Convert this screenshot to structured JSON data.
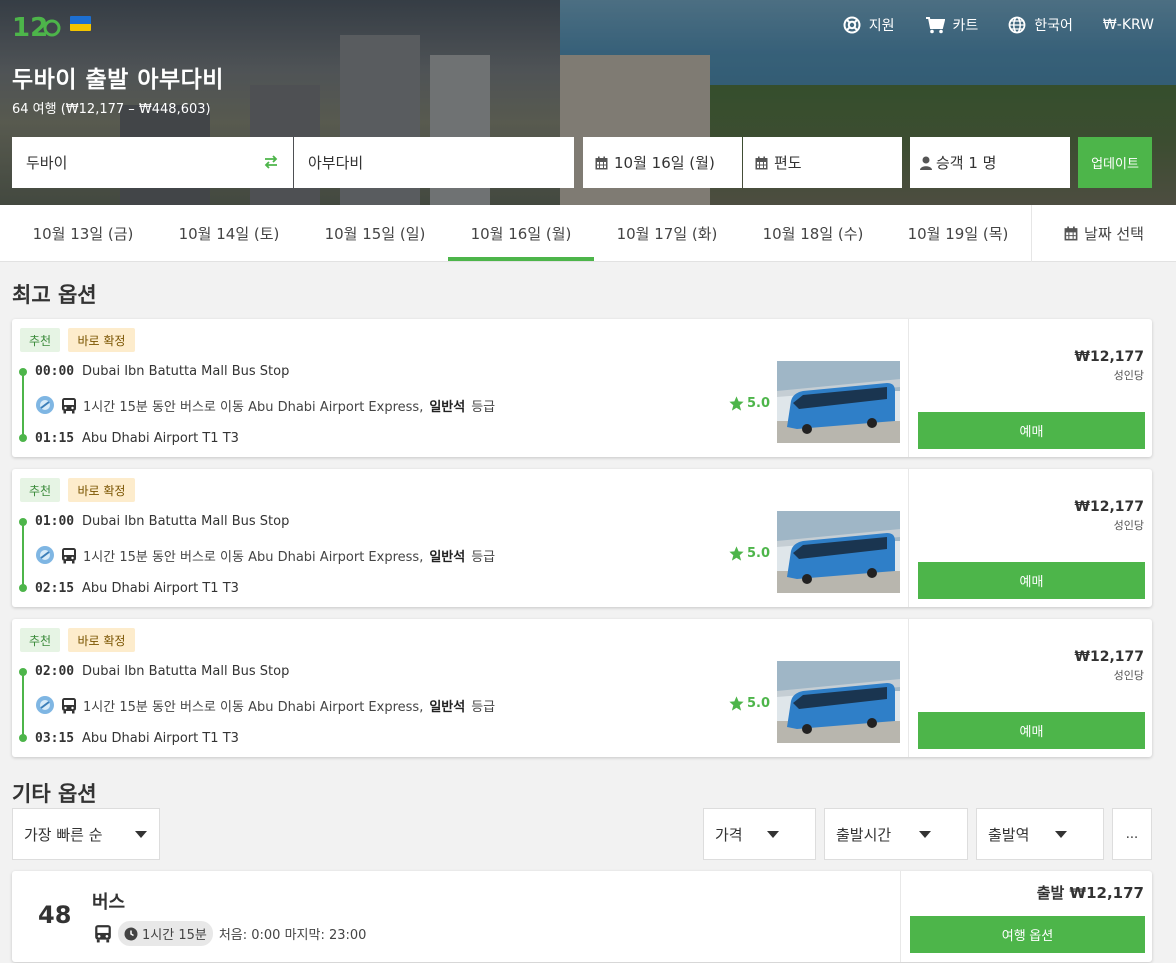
{
  "header": {
    "title": "두바이 출발 아부다비",
    "subtitle": "64 여행 (₩12,177 – ₩448,603)",
    "nav": {
      "support": "지원",
      "cart": "카트",
      "language": "한국어",
      "currency": "₩-KRW"
    }
  },
  "search": {
    "from": "두바이",
    "to": "아부다비",
    "date": "10월 16일 (월)",
    "return": "편도",
    "passengers": "승객 1 명",
    "update_label": "업데이트"
  },
  "date_tabs": [
    {
      "label": "10월 13일 (금)",
      "active": false
    },
    {
      "label": "10월 14일 (토)",
      "active": false
    },
    {
      "label": "10월 15일 (일)",
      "active": false
    },
    {
      "label": "10월 16일 (월)",
      "active": true
    },
    {
      "label": "10월 17일 (화)",
      "active": false
    },
    {
      "label": "10월 18일 (수)",
      "active": false
    },
    {
      "label": "10월 19일 (목)",
      "active": false
    }
  ],
  "date_pick_label": "날짜 선택",
  "best_options": {
    "title": "최고 옵션",
    "items": [
      {
        "badge_recommended": "추천",
        "badge_instant": "바로 확정",
        "depart_time": "00:00",
        "depart_stop": "Dubai Ibn Batutta Mall Bus Stop",
        "trip_text": "1시간 15분 동안 버스로 이동 Abu Dhabi Airport Express,",
        "class_text": "일반석",
        "class_suffix": "등급",
        "rating": "5.0",
        "arrive_time": "01:15",
        "arrive_stop": "Abu Dhabi Airport T1 T3",
        "price": "₩12,177",
        "per": "성인당",
        "buy_label": "예매"
      },
      {
        "badge_recommended": "추천",
        "badge_instant": "바로 확정",
        "depart_time": "01:00",
        "depart_stop": "Dubai Ibn Batutta Mall Bus Stop",
        "trip_text": "1시간 15분 동안 버스로 이동 Abu Dhabi Airport Express,",
        "class_text": "일반석",
        "class_suffix": "등급",
        "rating": "5.0",
        "arrive_time": "02:15",
        "arrive_stop": "Abu Dhabi Airport T1 T3",
        "price": "₩12,177",
        "per": "성인당",
        "buy_label": "예매"
      },
      {
        "badge_recommended": "추천",
        "badge_instant": "바로 확정",
        "depart_time": "02:00",
        "depart_stop": "Dubai Ibn Batutta Mall Bus Stop",
        "trip_text": "1시간 15분 동안 버스로 이동 Abu Dhabi Airport Express,",
        "class_text": "일반석",
        "class_suffix": "등급",
        "rating": "5.0",
        "arrive_time": "03:15",
        "arrive_stop": "Abu Dhabi Airport T1 T3",
        "price": "₩12,177",
        "per": "성인당",
        "buy_label": "예매"
      }
    ]
  },
  "other_options": {
    "title": "기타 옵션",
    "sort": "가장 빠른 순",
    "filters": {
      "price": "가격",
      "departure_time": "출발시간",
      "departure_station": "출발역",
      "more": "..."
    },
    "item": {
      "count": "48",
      "type": "버스",
      "duration": "1시간 15분",
      "schedule": "처음: 0:00 마지막: 23:00",
      "price": "출발 ₩12,177",
      "button": "여행 옵션"
    }
  },
  "colors": {
    "accent": "#4db54a",
    "badge_recommended_bg": "#e6f4e4",
    "badge_instant_bg": "#fdeccc"
  },
  "icons": [
    "logo-12go",
    "ukraine-flag-icon",
    "lifebuoy-icon",
    "cart-icon",
    "globe-icon",
    "swap-arrows-icon",
    "calendar-icon",
    "person-icon",
    "bus-icon",
    "star-icon",
    "clock-icon",
    "operator-logo-icon"
  ]
}
